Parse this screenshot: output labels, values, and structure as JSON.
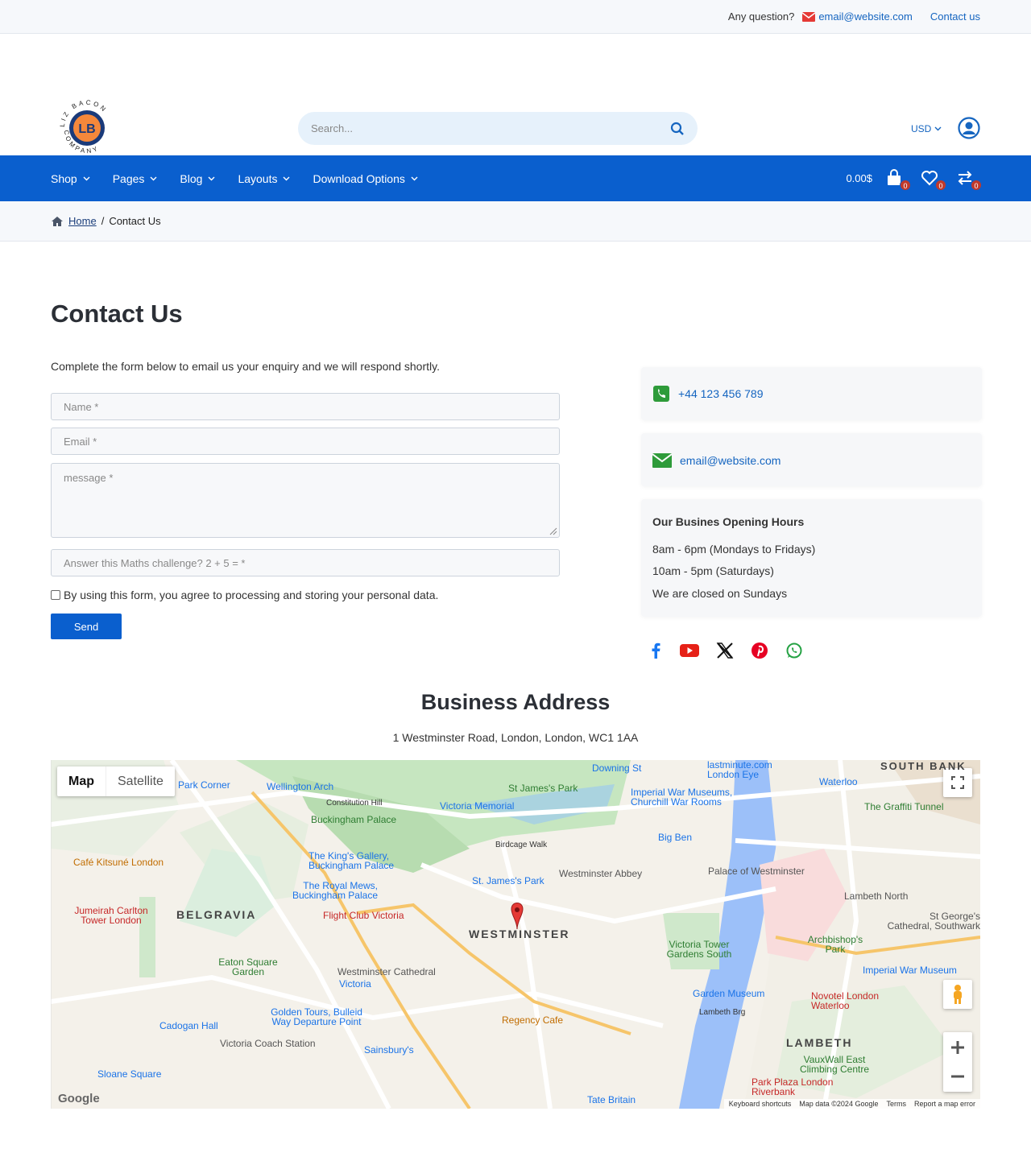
{
  "topbar": {
    "question": "Any question?",
    "email": "email@website.com",
    "contact": "Contact us"
  },
  "logo": {
    "initials": "LB",
    "arc_top": "LIZ BACON",
    "arc_bottom": "COMPANY"
  },
  "search": {
    "placeholder": "Search..."
  },
  "currency": {
    "label": "USD"
  },
  "nav": {
    "items": [
      "Shop",
      "Pages",
      "Blog",
      "Layouts",
      "Download Options"
    ],
    "cart_total": "0.00$",
    "cart_count": "0",
    "wishlist_count": "0",
    "compare_count": "0"
  },
  "breadcrumb": {
    "home": "Home",
    "separator": "/",
    "current": "Contact Us"
  },
  "contact": {
    "title": "Contact Us",
    "intro": "Complete the form below to email us your enquiry and we will respond shortly.",
    "form": {
      "name_placeholder": "Name *",
      "email_placeholder": "Email *",
      "message_placeholder": "message *",
      "captcha_placeholder": "Answer this Maths challenge?  2 + 5 = *",
      "agree_text": "By using this form, you agree to processing and storing your personal data.",
      "send_label": "Send"
    },
    "phone": "+44 123 456 789",
    "email": "email@website.com",
    "hours": {
      "title": "Our Busines Opening Hours",
      "lines": [
        "8am - 6pm (Mondays to Fridays)",
        "10am - 5pm (Saturdays)",
        "We are closed on Sundays"
      ]
    },
    "social": [
      "facebook-icon",
      "youtube-icon",
      "x-icon",
      "pinterest-icon",
      "whatsapp-icon"
    ]
  },
  "address": {
    "title": "Business Address",
    "line": "1 Westminster Road, London, London, WC1 1AA"
  },
  "map": {
    "tabs": [
      "Map",
      "Satellite"
    ],
    "brand": "Google",
    "attribution": [
      "Keyboard shortcuts",
      "Map data ©2024 Google",
      "Terms",
      "Report a map error"
    ],
    "labels": {
      "westminster": "WESTMINSTER",
      "belgravia": "BELGRAVIA",
      "lambeth": "LAMBETH",
      "southbank": "SOUTH BANK",
      "stjames": "St James's Park",
      "wellington": "Wellington Arch",
      "buckingham": "Buckingham Palace",
      "victoria": "Victoria",
      "bigben": "Big Ben",
      "abbey": "Westminster Abbey",
      "palace": "Palace of Westminster",
      "tate": "Tate Britain",
      "cathedral": "Westminster Cathedral",
      "sloane": "Sloane Square",
      "eaton": "Eaton Square Garden",
      "cadogan": "Cadogan Hall",
      "lambethnorth": "Lambeth North",
      "iwm": "Imperial War Museum",
      "novotel": "Novotel London Waterloo",
      "parkplaza": "Park Plaza London Riverbank",
      "regency": "Regency Cafe",
      "coach": "Victoria Coach Station",
      "sainsbury": "Sainsbury's",
      "victoriamemorial": "Victoria Memorial",
      "graffiti": "The Graffiti Tunnel",
      "constitution": "Constitution Hill",
      "birdcage": "Birdcage Walk",
      "towergardens": "Victoria Tower Gardens South",
      "gardenmuseum": "Garden Museum",
      "kitsune": "Café Kitsuné London",
      "jumeirah": "Jumeirah Carlton Tower London",
      "waterloo": "Waterloo",
      "downing": "Downing St",
      "lastminute": "lastminute.com London Eye",
      "stjamespark": "St. James's Park",
      "royalmews": "The Royal Mews, Buckingham Palace",
      "flightclub": "Flight Club Victoria",
      "kingsgallery": "The King's Gallery, Buckingham Palace",
      "iwmchurchill": "Imperial War Museums, Churchill War Rooms",
      "vauxwall": "VauxWall East Climbing Centre",
      "archbishop": "Archbishop's Park",
      "stgeorge": "St George's Cathedral, Southwark",
      "goldentours": "Golden Tours, Bulleid Way Departure Point",
      "lambethbrg": "Lambeth Brg",
      "hyde": "Park Corner",
      "stjamesmetro": "St. James's Park"
    }
  }
}
